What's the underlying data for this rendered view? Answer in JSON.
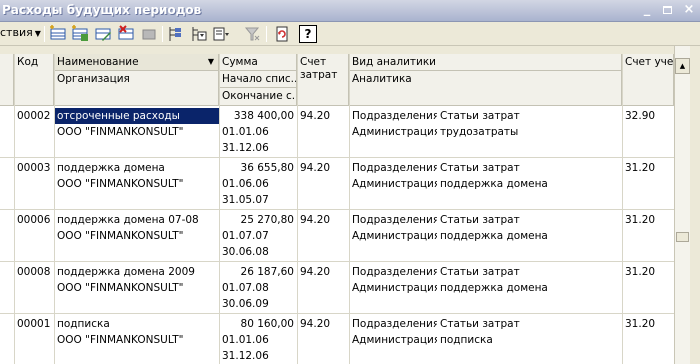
{
  "window": {
    "title": "Расходы будущих периодов",
    "min_glyph": "_",
    "close_glyph": "×"
  },
  "toolbar": {
    "actions_label": "ствия",
    "help_label": "?"
  },
  "columns": {
    "code": "Код",
    "name": "Наименование",
    "org": "Организация",
    "sum": "Сумма",
    "start": "Начало спис...",
    "end": "Окончание с...",
    "account": "Счет",
    "account2": "затрат",
    "analytics_kind": "Вид аналитики",
    "analytics": "Аналитика",
    "account_uch": "Счет учета"
  },
  "rows": [
    {
      "code": "00002",
      "name": "отсроченные расходы",
      "org": "ООО \"FINMANKONSULT\"",
      "sum": "338 400,00",
      "start": "01.01.06",
      "end": "31.12.06",
      "account": "94.20",
      "kind1": "Подразделения",
      "kind2": "Статьи затрат",
      "an1": "Администрация",
      "an2": "трудозатраты",
      "acc_uch": "32.90",
      "selected": true
    },
    {
      "code": "00003",
      "name": "поддержка домена",
      "org": "ООО \"FINMANKONSULT\"",
      "sum": "36 655,80",
      "start": "01.06.06",
      "end": "31.05.07",
      "account": "94.20",
      "kind1": "Подразделения",
      "kind2": "Статьи затрат",
      "an1": "Администрация",
      "an2": "поддержка домена",
      "acc_uch": "31.20"
    },
    {
      "code": "00006",
      "name": "поддержка домена 07-08",
      "org": "ООО \"FINMANKONSULT\"",
      "sum": "25 270,80",
      "start": "01.07.07",
      "end": "30.06.08",
      "account": "94.20",
      "kind1": "Подразделения",
      "kind2": "Статьи затрат",
      "an1": "Администрация",
      "an2": "поддержка домена",
      "acc_uch": "31.20"
    },
    {
      "code": "00008",
      "name": "поддержка домена 2009",
      "org": "ООО \"FINMANKONSULT\"",
      "sum": "26 187,60",
      "start": "01.07.08",
      "end": "30.06.09",
      "account": "94.20",
      "kind1": "Подразделения",
      "kind2": "Статьи затрат",
      "an1": "Администрация",
      "an2": "поддержка домена",
      "acc_uch": "31.20"
    },
    {
      "code": "00001",
      "name": "подписка",
      "org": "ООО \"FINMANKONSULT\"",
      "sum": "80 160,00",
      "start": "01.01.06",
      "end": "31.12.06",
      "account": "94.20",
      "kind1": "Подразделения",
      "kind2": "Статьи затрат",
      "an1": "Администрация",
      "an2": "подписка",
      "acc_uch": "31.20"
    }
  ],
  "icons": [
    "add-row-icon",
    "add-copy-icon",
    "edit-icon",
    "delete-icon",
    "mark-icon",
    "hierarchy-icon",
    "filter-icon",
    "filter-dropdown-icon",
    "clear-filter-icon",
    "refresh-icon",
    "help-icon"
  ]
}
